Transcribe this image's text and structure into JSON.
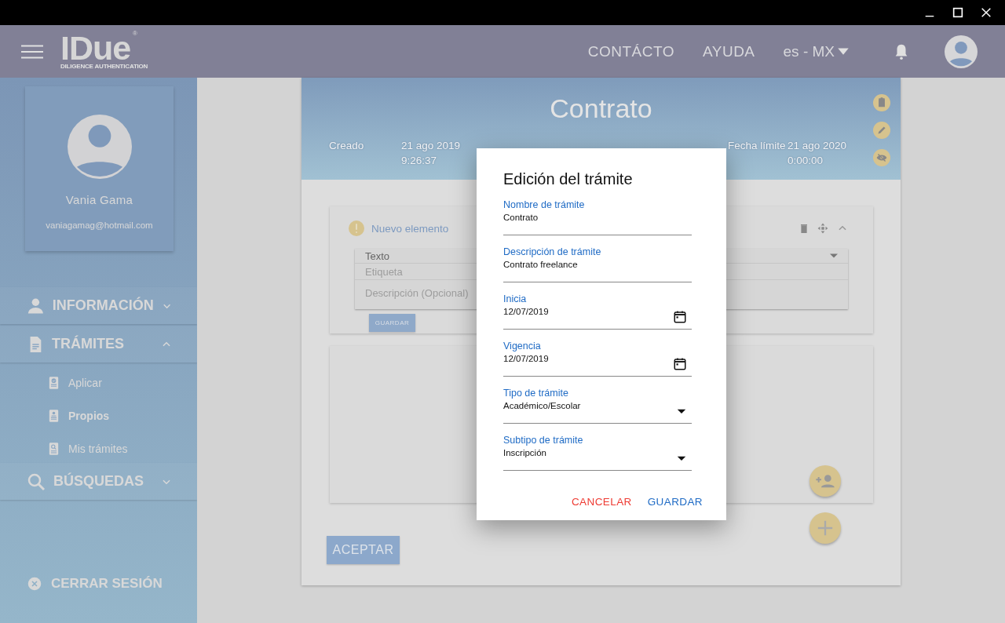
{
  "app_bar": {
    "logo": {
      "name": "IDue",
      "mark": "®",
      "tagline": "DILIGENCE AUTHENTICATION"
    },
    "nav": [
      {
        "label": "CONTÁCTO"
      },
      {
        "label": "AYUDA"
      }
    ],
    "language": "es - MX"
  },
  "profile": {
    "name": "Vania Gama",
    "email": "vaniagamag@hotmail.com"
  },
  "sidebar": {
    "sections": [
      {
        "label": "INFORMACIÓN",
        "kind": "person",
        "expanded": false
      },
      {
        "label": "TRÁMITES",
        "kind": "document",
        "expanded": true,
        "children": [
          {
            "label": "Aplicar",
            "kind": "check",
            "selected": false
          },
          {
            "label": "Propios",
            "kind": "person",
            "selected": true
          },
          {
            "label": "Mis trámites",
            "kind": "search",
            "selected": false
          }
        ]
      },
      {
        "label": "BÚSQUEDAS",
        "kind": "search",
        "expanded": false
      }
    ],
    "logout": "CERRAR SESIÓN"
  },
  "record": {
    "title": "Contrato",
    "meta": [
      {
        "label": "Creado",
        "value": [
          "21 ago 2019",
          "9:26:37"
        ]
      },
      {
        "label": "Fecha límite",
        "value": [
          "21 ago 2020",
          "0:00:00"
        ]
      }
    ],
    "element": {
      "title": "Nuevo elemento",
      "type": "Texto",
      "label_placeholder": "Etiqueta",
      "description_placeholder": "Descripción (Opcional)",
      "save": "GUARDAR"
    },
    "accept": "ACEPTAR"
  },
  "dialog": {
    "title": "Edición del trámite",
    "fields": [
      {
        "kind": "text",
        "label": "Nombre de trámite",
        "value": "Contrato"
      },
      {
        "kind": "text",
        "label": "Descripción de trámite",
        "value": "Contrato freelance"
      },
      {
        "kind": "date",
        "label": "Inicia",
        "value": "12/07/2019"
      },
      {
        "kind": "date",
        "label": "Vigencia",
        "value": "12/07/2019"
      },
      {
        "kind": "select",
        "label": "Tipo de trámite",
        "value": "Académico/Escolar"
      },
      {
        "kind": "select",
        "label": "Subtipo de trámite",
        "value": "Inscripción"
      }
    ],
    "actions": [
      {
        "kind": "cancel",
        "label": "CANCELAR"
      },
      {
        "kind": "confirm",
        "label": "GUARDAR"
      }
    ]
  }
}
